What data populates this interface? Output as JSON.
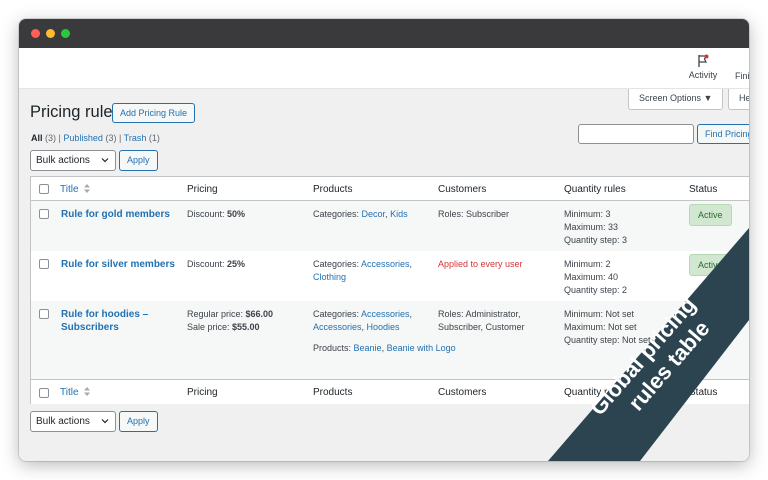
{
  "window": {
    "traffic_lights": [
      "close",
      "minimize",
      "maximize"
    ]
  },
  "adminbar": {
    "activity_label": "Activity",
    "finish_label": "Fini"
  },
  "screen_options": {
    "label": "Screen Options ▼",
    "help_label": "He"
  },
  "page": {
    "title": "Pricing rule",
    "add_button": "Add Pricing Rule"
  },
  "views": {
    "all_label": "All",
    "all_count": "(3)",
    "published_label": "Published",
    "published_count": "(3)",
    "trash_label": "Trash",
    "trash_count": "(1)",
    "sep": "|"
  },
  "search": {
    "placeholder": "",
    "button": "Find Pricing"
  },
  "bulk": {
    "selected": "Bulk actions",
    "apply": "Apply"
  },
  "table": {
    "headers": {
      "title": "Title",
      "pricing": "Pricing",
      "products": "Products",
      "customers": "Customers",
      "quantity": "Quantity rules",
      "status": "Status"
    },
    "footer_quantity": "Quantity r",
    "rows": [
      {
        "title": "Rule for gold members",
        "pricing_label": "Discount: ",
        "pricing_value": "50%",
        "products_label": "Categories: ",
        "products_links": [
          "Decor",
          "Kids"
        ],
        "customers": "Roles: Subscriber",
        "qty": [
          "Minimum: 3",
          "Maximum: 33",
          "Quantity step: 3"
        ],
        "status": "Active"
      },
      {
        "title": "Rule for silver members",
        "pricing_label": "Discount: ",
        "pricing_value": "25%",
        "products_label": "Categories: ",
        "products_links": [
          "Accessories",
          "Clothing"
        ],
        "customers": "Applied to every user",
        "qty": [
          "Minimum: 2",
          "Maximum: 40",
          "Quantity step: 2"
        ],
        "status": "Active"
      },
      {
        "title_line1": "Rule for hoodies –",
        "title_line2": "Subscribers",
        "regular_label": "Regular price: ",
        "regular_value": "$66.00",
        "sale_label": "Sale price: ",
        "sale_value": "$55.00",
        "products_label": "Categories: ",
        "products_links": [
          "Accessories",
          "Accessories",
          "Hoodies"
        ],
        "products2_label": "Products: ",
        "products2_links": [
          "Beanie",
          "Beanie with Logo"
        ],
        "customers_line1": "Roles: Administrator,",
        "customers_line2": "Subscriber, Customer",
        "qty": [
          "Minimum: Not set",
          "Maximum: Not set",
          "Quantity step: Not set"
        ]
      }
    ]
  },
  "ribbon": {
    "line1": "Global pricing",
    "line2": "rules table",
    "color": "#2c4450"
  },
  "colors": {
    "link": "#2271b1",
    "error": "#d63638",
    "active_bg": "#d1e7d0",
    "active_text": "#2e6b30"
  }
}
